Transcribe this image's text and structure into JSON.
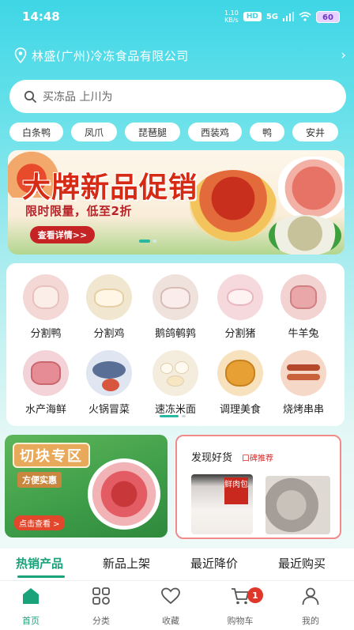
{
  "status": {
    "time": "14:48",
    "speed_top": "1.10",
    "speed_unit": "KB/s",
    "hd": "HD",
    "net": "5G",
    "battery": "60"
  },
  "location": {
    "text": "林盛(广州)冷冻食品有限公司"
  },
  "search": {
    "placeholder": "买冻品 上川为"
  },
  "chips": [
    "白条鸭",
    "凤爪",
    "琵琶腿",
    "西装鸡",
    "鸭",
    "安井"
  ],
  "banner": {
    "title": "大牌新品促销",
    "subtitle": "限时限量，低至2折",
    "button": "查看详情>>"
  },
  "categories": [
    {
      "label": "分割鸭",
      "icon": "duck-meat-icon",
      "color": "#f4d8d6"
    },
    {
      "label": "分割鸡",
      "icon": "chicken-meat-icon",
      "color": "#f1e6cf"
    },
    {
      "label": "鹅鸽鹌鹑",
      "icon": "poultry-icon",
      "color": "#efe1dc"
    },
    {
      "label": "分割猪",
      "icon": "pig-icon",
      "color": "#f6d9dd"
    },
    {
      "label": "牛羊兔",
      "icon": "beef-lamb-icon",
      "color": "#f3d2d2"
    },
    {
      "label": "水产海鲜",
      "icon": "seafood-icon",
      "color": "#f3d3d7"
    },
    {
      "label": "火锅冒菜",
      "icon": "hotpot-icon",
      "color": "#dfe5f1"
    },
    {
      "label": "速冻米面",
      "icon": "dumpling-icon",
      "color": "#f4ecdd"
    },
    {
      "label": "调理美食",
      "icon": "prepared-food-icon",
      "color": "#f8e2bd"
    },
    {
      "label": "烧烤串串",
      "icon": "bbq-icon",
      "color": "#f5d8c8"
    }
  ],
  "promo_left": {
    "title": "切块专区",
    "subtitle": "方便实惠",
    "cta": "点击查看 >"
  },
  "promo_right": {
    "title": "发现好货",
    "tag": "口碑推荐",
    "product_label": "鲜肉包"
  },
  "tabs": [
    "热销产品",
    "新品上架",
    "最近降价",
    "最近购买"
  ],
  "bottom_nav": [
    {
      "label": "首页",
      "icon": "home-icon"
    },
    {
      "label": "分类",
      "icon": "category-icon"
    },
    {
      "label": "收藏",
      "icon": "heart-icon"
    },
    {
      "label": "购物车",
      "icon": "cart-icon"
    },
    {
      "label": "我的",
      "icon": "user-icon"
    }
  ],
  "cart_count": "1",
  "colors": {
    "accent": "#1aa37a",
    "banner_red": "#d62a14",
    "badge_red": "#e0372b"
  }
}
